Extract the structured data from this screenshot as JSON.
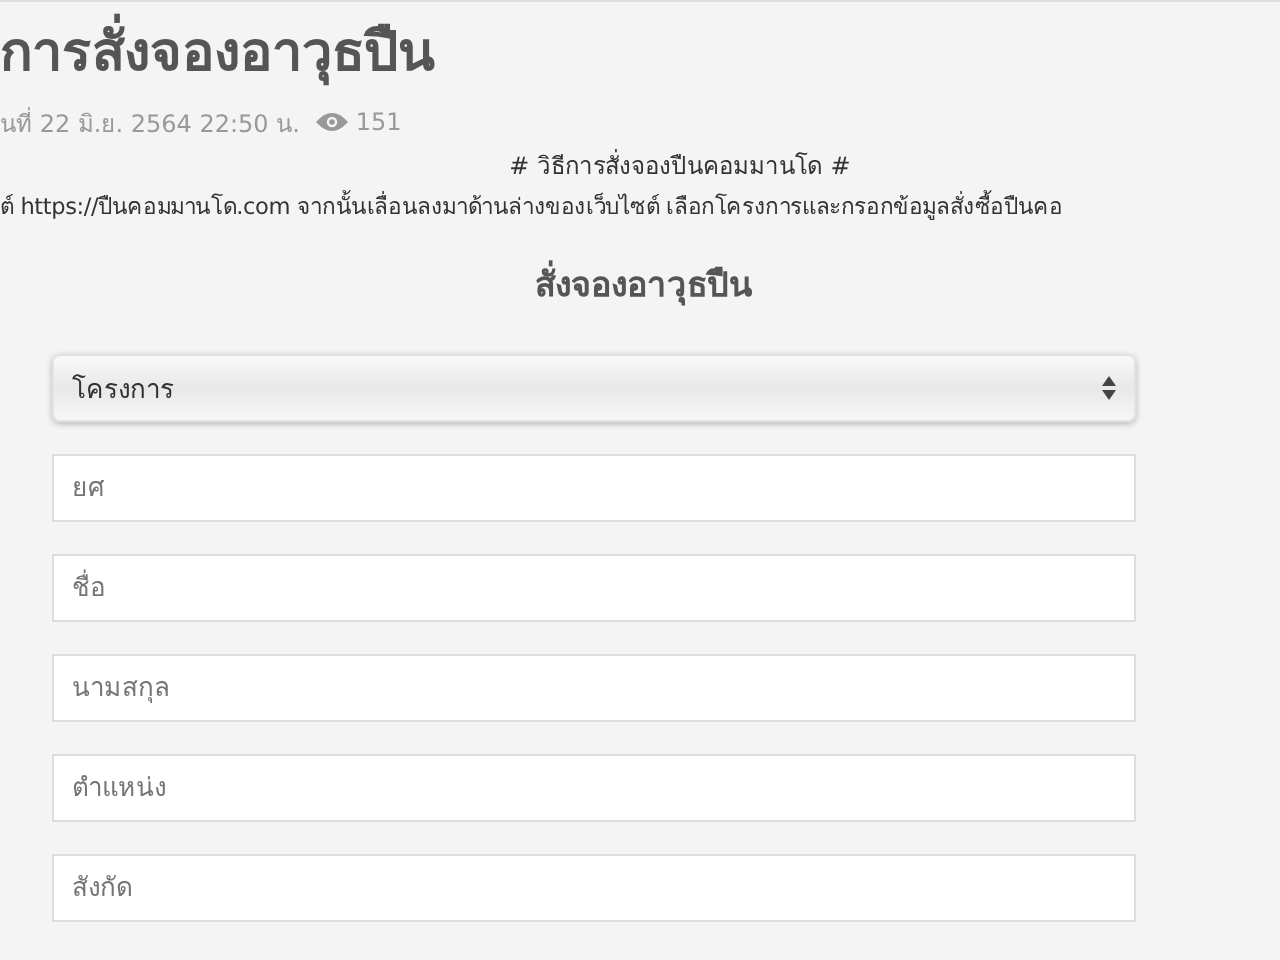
{
  "article": {
    "title": "การสั่งจองอาวุธปืน",
    "date": "นที่ 22 มิ.ย. 2564 22:50 น.",
    "views": "151",
    "intro_heading": "# วิธีการสั่งจองปืนคอมมานโด #",
    "intro_text": "ต์ https://ปืนคอมมานโด.com จากนั้นเลื่อนลงมาด้านล่างของเว็บไซต์ เลือกโครงการและกรอกข้อมูลสั่งซื้อปืนคอ"
  },
  "form": {
    "title": "สั่งจองอาวุธปืน",
    "fields": [
      {
        "kind": "select",
        "placeholder": "โครงการ"
      },
      {
        "kind": "text",
        "placeholder": "ยศ"
      },
      {
        "kind": "text",
        "placeholder": "ชื่อ"
      },
      {
        "kind": "text",
        "placeholder": "นามสกุล"
      },
      {
        "kind": "text",
        "placeholder": "ตำแหน่ง"
      },
      {
        "kind": "text",
        "placeholder": "สังกัด"
      }
    ]
  }
}
